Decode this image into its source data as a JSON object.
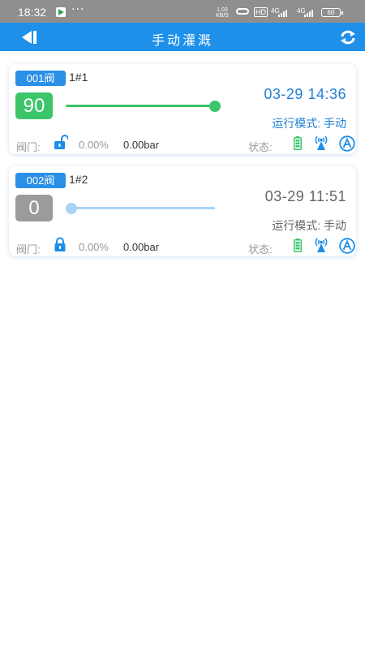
{
  "status_bar": {
    "time": "18:32",
    "dots": "···",
    "net_speed_value": "1.03",
    "net_speed_unit": "KB/S",
    "hd_label": "HD",
    "signal1": "4G",
    "signal2": "4G",
    "battery": "60"
  },
  "header": {
    "title": "手动灌溉",
    "back_icon": "back-arrow-icon",
    "refresh_icon": "refresh-icon",
    "color": "#1e90ea"
  },
  "devices": [
    {
      "badge": "001阀",
      "name": "1#1",
      "value": "90",
      "value_color": "#3cc569",
      "slider_fraction": 1.0,
      "slider_color": "#3cc569",
      "datetime": "03-29 14:36",
      "mode": "运行模式: 手动",
      "text_color": "#1f7fd6",
      "valve_label": "阀门:",
      "lock_state": "unlocked",
      "percent": "0.00%",
      "pressure": "0.00bar",
      "status_label": "状态:"
    },
    {
      "badge": "002阀",
      "name": "1#2",
      "value": "0",
      "value_color": "#9b9b9b",
      "slider_fraction": 0.0,
      "slider_color": "#a9d2f6",
      "datetime": "03-29 11:51",
      "mode": "运行模式: 手动",
      "text_color": "#666666",
      "valve_label": "阀门:",
      "lock_state": "locked",
      "percent": "0.00%",
      "pressure": "0.00bar",
      "status_label": "状态:"
    }
  ],
  "colors": {
    "accent": "#2a8fe6",
    "battery_green": "#3cc569"
  }
}
